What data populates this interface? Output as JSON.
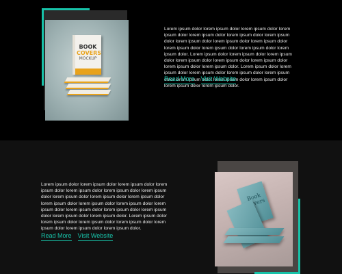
{
  "section1": {
    "paragraph": "Lorem ipsum dolor lorem ipsum dolor lorem ipsum dolor lorem ipsum dolor lorem ipsum dolor lorem ipsum dolor lorem ipsum dolor lorem ipsum dolor lorem ipsum dolor lorem ipsum dolor lorem ipsum dolor lorem ipsum dolor lorem ipsum dolor lorem ipsum dolor. Lorem ipsum dolor lorem ipsum dolor lorem ipsum dolor lorem ipsum dolor lorem ipsum dolor lorem ipsum dolor lorem ipsum dolor lorem ipsum dolor. Lorem ipsum dolor lorem ipsum dolor lorem ipsum dolor lorem ipsum dolor lorem ipsum dolor lorem ipsum dolor lorem ipsum dolor lorem ipsum dolor lorem ipsum dolor lorem ipsum dolor.",
    "read_more": "Read More",
    "visit": "Visit Website",
    "mockup_title_1": "BOOK",
    "mockup_title_2": "COVERS",
    "mockup_title_3": "MOCKUP"
  },
  "section2": {
    "paragraph": "Lorem ipsum dolor lorem ipsum dolor lorem ipsum dolor lorem ipsum dolor lorem ipsum dolor lorem ipsum dolor lorem ipsum dolor lorem ipsum dolor lorem ipsum dolor lorem ipsum dolor lorem ipsum dolor lorem ipsum dolor lorem ipsum dolor lorem ipsum dolor lorem ipsum dolor lorem ipsum dolor lorem ipsum dolor lorem ipsum dolor lorem ipsum dolor. Lorem ipsum dolor lorem ipsum dolor lorem ipsum dolor lorem ipsum dolor lorem ipsum dolor lorem ipsum dolor lorem ipsum dolor.",
    "read_more": "Read More",
    "visit": "Visit Website",
    "mockup_caption": "Book Covers"
  },
  "colors": {
    "accent": "#18c6ac",
    "section1_bg": "#000000",
    "section2_bg": "#111111"
  }
}
